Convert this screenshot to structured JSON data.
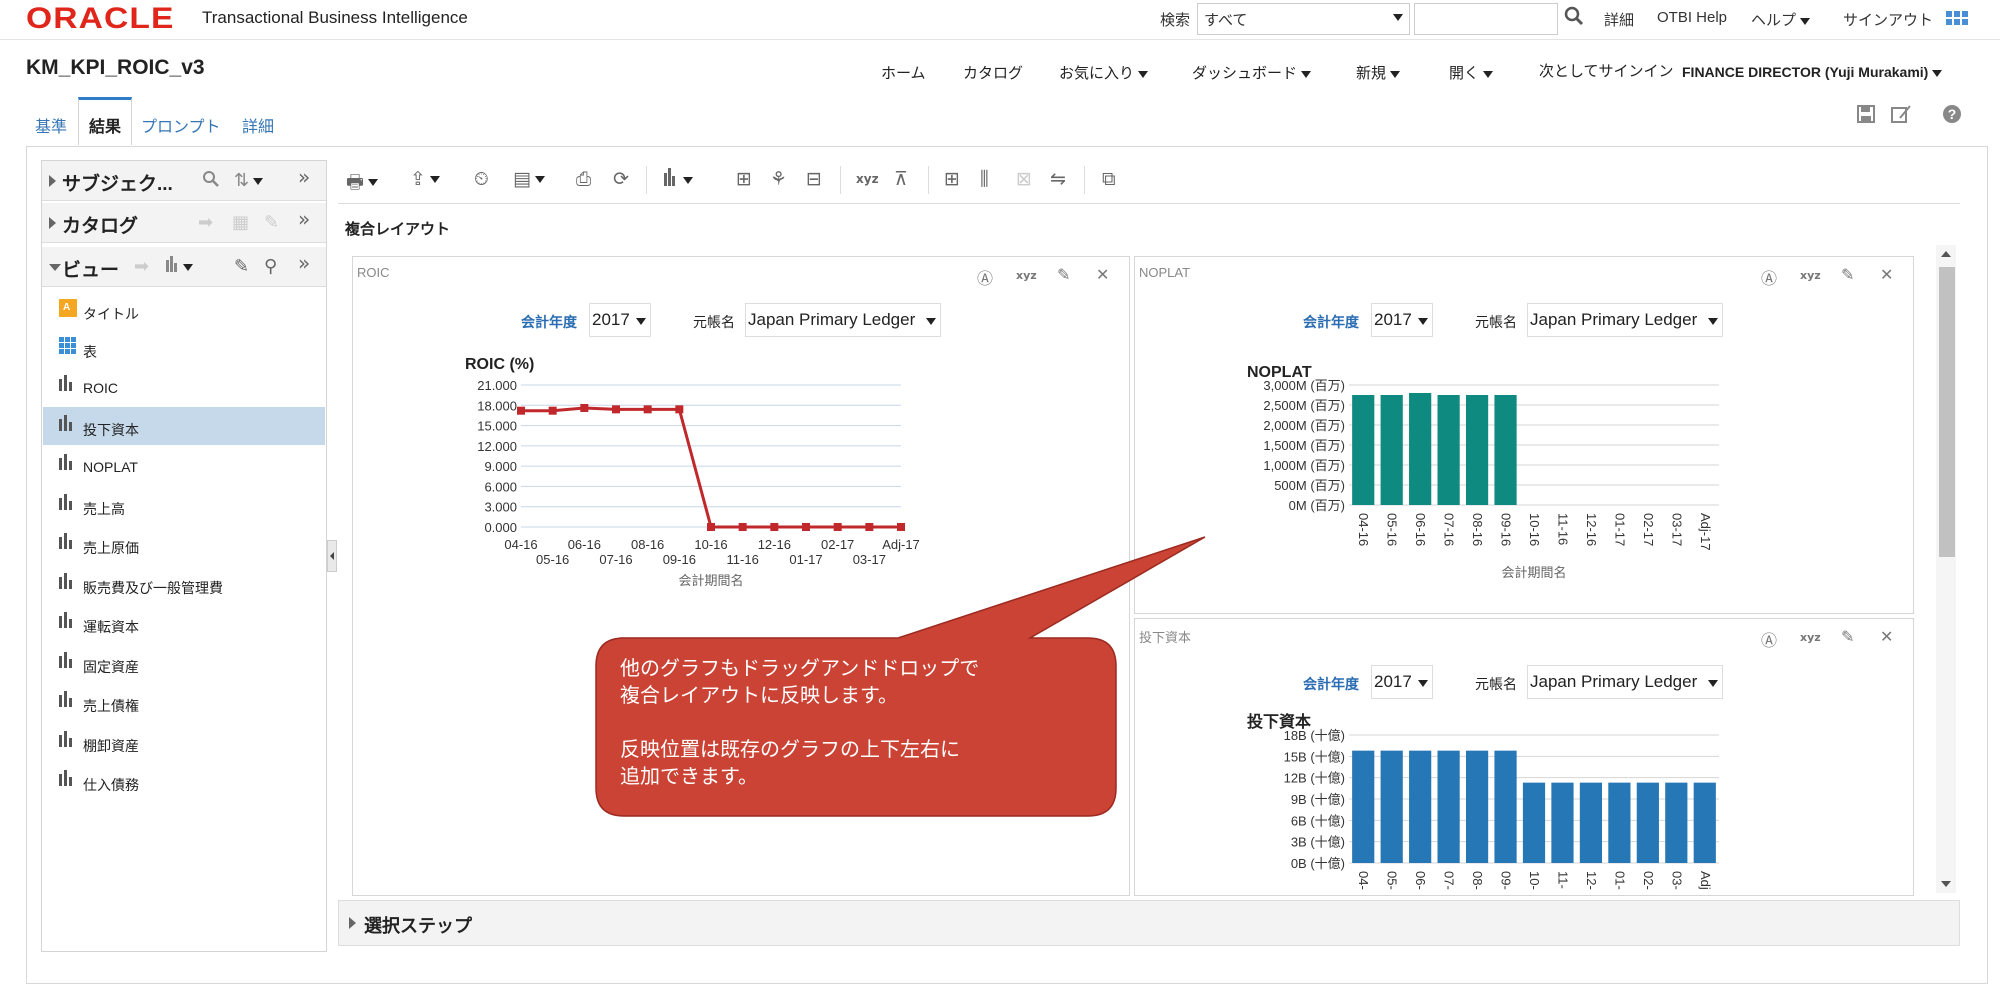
{
  "header": {
    "logo": "ORACLE",
    "app_name": "Transactional Business Intelligence",
    "search_label": "検索",
    "search_scope": "すべて",
    "search_query": "",
    "links": [
      "詳細",
      "OTBI Help",
      "ヘルプ",
      "サインアウト"
    ]
  },
  "page": {
    "title": "KM_KPI_ROIC_v3",
    "nav": [
      "ホーム",
      "カタログ",
      "お気に入り",
      "ダッシュボード",
      "新規",
      "開く",
      "次としてサインイン"
    ],
    "signed_in_as": "FINANCE DIRECTOR (Yuji Murakami)",
    "tabs": [
      "基準",
      "結果",
      "プロンプト",
      "詳細"
    ],
    "active_tab": "結果"
  },
  "left_panel": {
    "sections": [
      "サブジェク...",
      "カタログ",
      "ビュー"
    ],
    "views": [
      {
        "label": "タイトル",
        "icon": "title-icon"
      },
      {
        "label": "表",
        "icon": "table-icon"
      },
      {
        "label": "ROIC",
        "icon": "bar-chart-icon"
      },
      {
        "label": "投下資本",
        "icon": "bar-chart-icon",
        "selected": true
      },
      {
        "label": "NOPLAT",
        "icon": "bar-chart-icon"
      },
      {
        "label": "売上高",
        "icon": "bar-chart-icon"
      },
      {
        "label": "売上原価",
        "icon": "bar-chart-icon"
      },
      {
        "label": "販売費及び一般管理費",
        "icon": "bar-chart-icon"
      },
      {
        "label": "運転資本",
        "icon": "bar-chart-icon"
      },
      {
        "label": "固定資産",
        "icon": "bar-chart-icon"
      },
      {
        "label": "売上債権",
        "icon": "bar-chart-icon"
      },
      {
        "label": "棚卸資産",
        "icon": "bar-chart-icon"
      },
      {
        "label": "仕入債務",
        "icon": "bar-chart-icon"
      }
    ]
  },
  "composite_label": "複合レイアウト",
  "prompts": {
    "year_label": "会計年度",
    "year_value": "2017",
    "ledger_label": "元帳名",
    "ledger_value": "Japan Primary Ledger"
  },
  "views": {
    "roic_title": "ROIC",
    "noplat_title": "NOPLAT",
    "invested_title": "投下資本"
  },
  "callout": {
    "line1": "他のグラフもドラッグアンドドロップで",
    "line2": "複合レイアウトに反映します。",
    "line3": "反映位置は既存のグラフの上下左右に",
    "line4": "追加できます。",
    "color": "#cb4335"
  },
  "selection_steps": "選択ステップ",
  "chart_data": [
    {
      "type": "line",
      "title": "ROIC (%)",
      "xlabel": "会計期間名",
      "categories": [
        "04-16",
        "05-16",
        "06-16",
        "07-16",
        "08-16",
        "09-16",
        "10-16",
        "11-16",
        "12-16",
        "01-17",
        "02-17",
        "03-17",
        "Adj-17"
      ],
      "series": [
        {
          "values": [
            17.2,
            17.2,
            17.6,
            17.4,
            17.4,
            17.4,
            0,
            0,
            0,
            0,
            0,
            0,
            0
          ]
        }
      ],
      "ylim": [
        0,
        21
      ],
      "yticks": [
        "21.000",
        "18.000",
        "15.000",
        "12.000",
        "9.000",
        "6.000",
        "3.000",
        "0.000"
      ],
      "color": "#c0282c"
    },
    {
      "type": "bar",
      "title": "NOPLAT",
      "xlabel": "会計期間名",
      "categories": [
        "04-16",
        "05-16",
        "06-16",
        "07-16",
        "08-16",
        "09-16",
        "10-16",
        "11-16",
        "12-16",
        "01-17",
        "02-17",
        "03-17",
        "Adj-17"
      ],
      "values": [
        2750,
        2750,
        2800,
        2750,
        2750,
        2750,
        0,
        0,
        0,
        0,
        0,
        0,
        0
      ],
      "ylim": [
        0,
        3000
      ],
      "yticks": [
        "3,000M (百万)",
        "2,500M (百万)",
        "2,000M (百万)",
        "1,500M (百万)",
        "1,000M (百万)",
        "500M (百万)",
        "0M (百万)"
      ],
      "color": "#0f8a80"
    },
    {
      "type": "bar",
      "title": "投下資本",
      "categories": [
        "04-",
        "05-",
        "06-",
        "07-",
        "08-",
        "09-",
        "10-",
        "11-",
        "12-",
        "01-",
        "02-",
        "03-",
        "Adj"
      ],
      "values": [
        15.8,
        15.8,
        15.8,
        15.8,
        15.8,
        15.8,
        11.3,
        11.3,
        11.3,
        11.3,
        11.3,
        11.3,
        11.3
      ],
      "ylim": [
        0,
        18
      ],
      "yticks": [
        "18B (十億)",
        "15B (十億)",
        "12B (十億)",
        "9B (十億)",
        "6B (十億)",
        "3B (十億)",
        "0B (十億)"
      ],
      "color": "#2677b5"
    }
  ]
}
